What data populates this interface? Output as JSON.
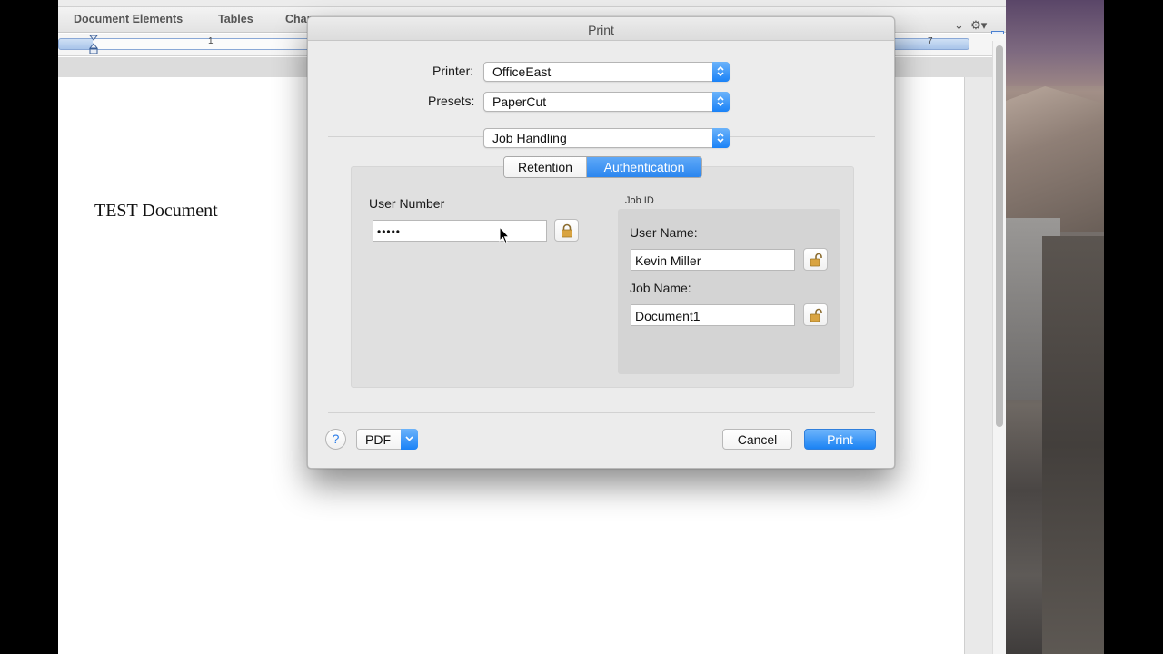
{
  "word": {
    "ribbon_tabs": [
      "Document Elements",
      "Tables",
      "Char"
    ],
    "ruler_numbers": [
      "1",
      "7"
    ],
    "document_text": "TEST Document"
  },
  "dialog": {
    "title": "Print",
    "printer_label": "Printer:",
    "printer_value": "OfficeEast",
    "presets_label": "Presets:",
    "presets_value": "PaperCut",
    "panel_value": "Job Handling",
    "tabs": [
      {
        "label": "Retention",
        "selected": false
      },
      {
        "label": "Authentication",
        "selected": true
      }
    ],
    "user_number_label": "User Number",
    "user_number_value": "•••••",
    "job_id_label": "Job ID",
    "user_name_label": "User Name:",
    "user_name_value": "Kevin Miller",
    "job_name_label": "Job Name:",
    "job_name_value": "Document1",
    "help_label": "?",
    "pdf_label": "PDF",
    "cancel_label": "Cancel",
    "print_label": "Print"
  },
  "colors": {
    "accent_blue": "#1a82f7",
    "dialog_bg": "#ececec"
  },
  "icons": {
    "lock_closed": "lock-icon",
    "lock_open": "unlock-icon",
    "help": "help-icon",
    "stepper": "up-down-chevron-icon"
  }
}
